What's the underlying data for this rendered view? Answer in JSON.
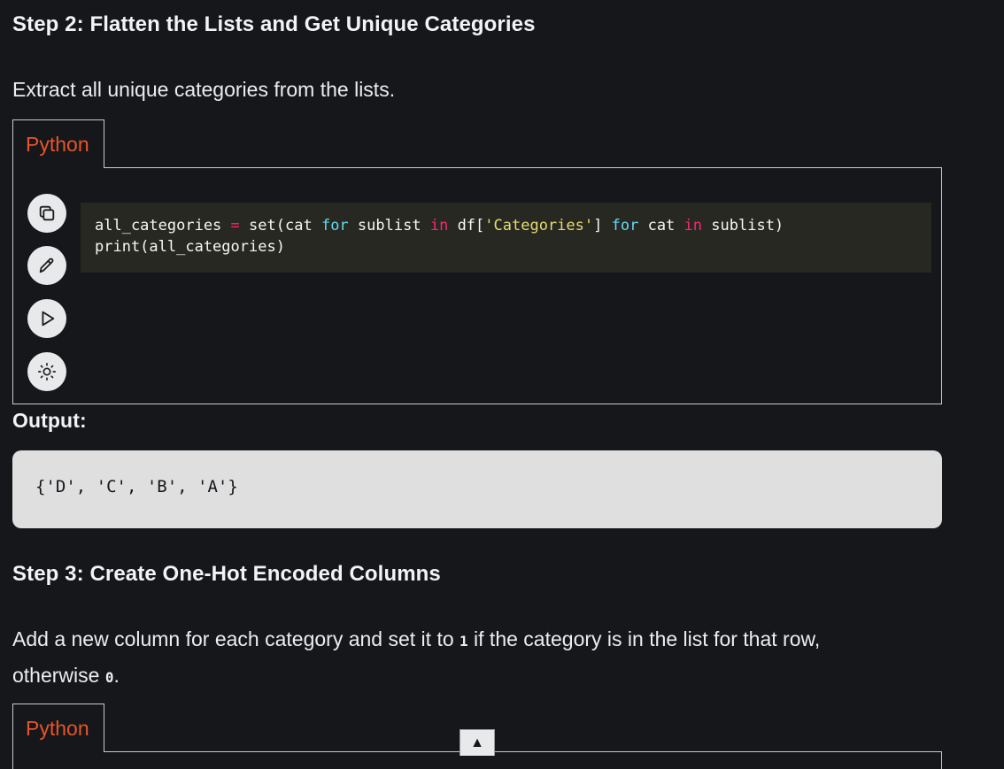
{
  "step2": {
    "heading": "Step 2: Flatten the Lists and Get Unique Categories",
    "description": "Extract all unique categories from the lists.",
    "tab_label": "Python",
    "code": {
      "line1": {
        "var": "all_categories",
        "eq": "=",
        "call": "set(cat",
        "for1": "for",
        "name1": "sublist",
        "in1": "in",
        "df": "df[",
        "string": "'Categories'",
        "close": "]",
        "for2": "for",
        "name2": "cat",
        "in2": "in",
        "tail": "sublist)"
      },
      "line2": "print(all_categories)"
    },
    "output_label": "Output:",
    "output": "{'D', 'C', 'B', 'A'}"
  },
  "step3": {
    "heading": "Step 3: Create One-Hot Encoded Columns",
    "description_part1": "Add a new column for each category and set it to",
    "code1": "1",
    "description_part2": "if the category is in the list for that row,",
    "description_part3": "otherwise",
    "code2": "0",
    "description_part4": ".",
    "tab_label": "Python"
  },
  "icons": [
    "copy-icon",
    "edit-icon",
    "run-icon",
    "theme-icon",
    "scroll-top-icon"
  ],
  "scroll_top_glyph": "▲"
}
